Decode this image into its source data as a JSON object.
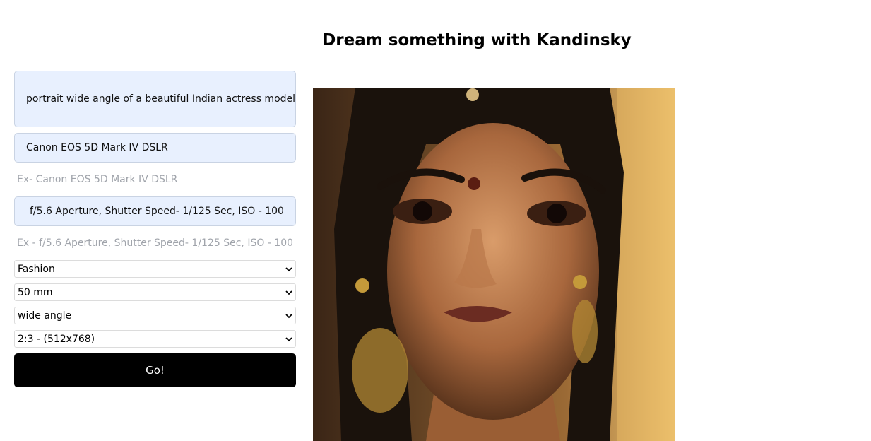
{
  "page": {
    "title": "Dream something with Kandinsky"
  },
  "form": {
    "prompt_value": "portrait wide angle of a beautiful Indian actress model in a",
    "camera_value": "Canon EOS 5D Mark IV DSLR",
    "camera_hint": "Ex- Canon EOS 5D Mark IV DSLR",
    "settings_value": "f/5.6 Aperture, Shutter Speed- 1/125 Sec, ISO - 100",
    "settings_hint": "Ex - f/5.6 Aperture, Shutter Speed- 1/125 Sec, ISO - 100",
    "style_select": "Fashion",
    "lens_select": "50 mm",
    "angle_select": "wide angle",
    "ratio_select": "2:3 - (512x768)",
    "go_label": "Go!"
  },
  "icons": {
    "dropdown": "chevron-down-icon"
  }
}
